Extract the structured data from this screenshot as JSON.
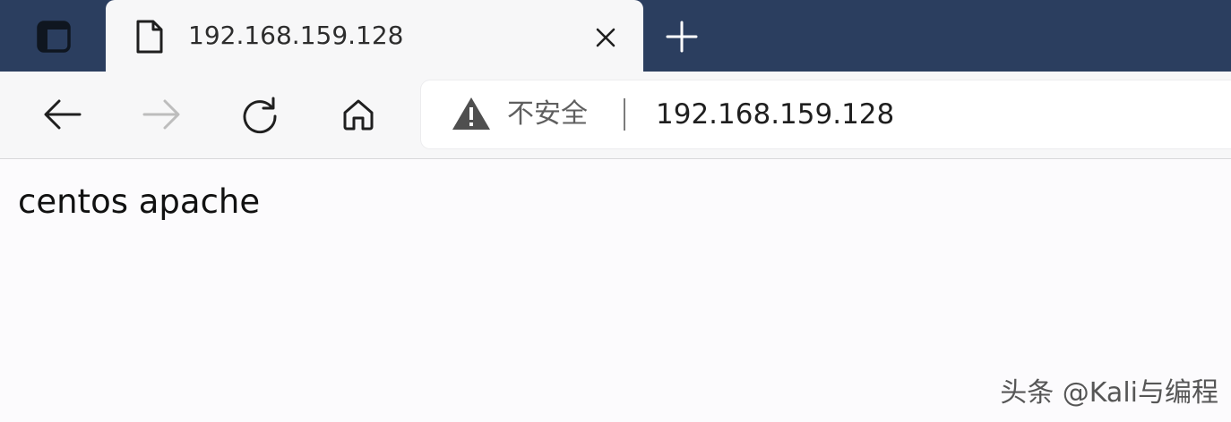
{
  "tab": {
    "title": "192.168.159.128"
  },
  "address_bar": {
    "security_label": "不安全",
    "url": "192.168.159.128"
  },
  "page": {
    "body_text": "centos apache"
  },
  "watermark": {
    "text": "头条 @Kali与编程"
  },
  "icons": {
    "tab_actions": "tab-actions-icon",
    "favicon": "document-icon",
    "close": "close-icon",
    "new_tab": "plus-icon",
    "back": "arrow-left-icon",
    "forward": "arrow-right-icon",
    "refresh": "refresh-icon",
    "home": "home-icon",
    "security": "warning-triangle-icon"
  },
  "colors": {
    "tabstrip": "#2b3e5f",
    "toolbar": "#f7f7f8",
    "page_background": "#fcfbfd"
  }
}
